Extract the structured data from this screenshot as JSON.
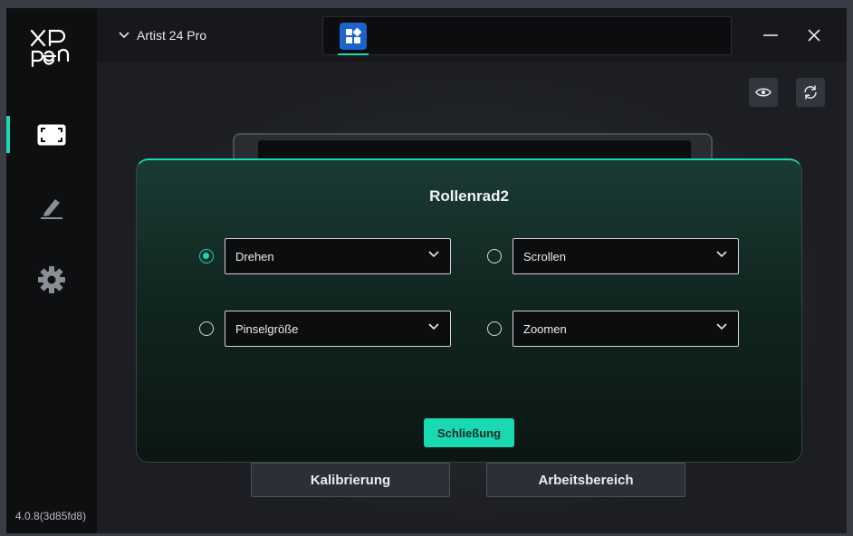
{
  "app": {
    "logo_text": "XP pen",
    "version": "4.0.8(3d85fd8)"
  },
  "header": {
    "device_name": "Artist 24 Pro",
    "add_tab_icon": "plus-icon",
    "remove_tab_icon": "minus-icon"
  },
  "sidebar": {
    "items": [
      {
        "icon": "display-area-icon",
        "active": true
      },
      {
        "icon": "pen-icon",
        "active": false
      },
      {
        "icon": "gear-icon",
        "active": false
      }
    ]
  },
  "main": {
    "calibrate_label": "Kalibrierung",
    "workspace_label": "Arbeitsbereich"
  },
  "modal": {
    "title": "Rollenrad2",
    "options": [
      {
        "value": "Drehen",
        "checked": true
      },
      {
        "value": "Scrollen",
        "checked": false
      },
      {
        "value": "Pinselgröße",
        "checked": false
      },
      {
        "value": "Zoomen",
        "checked": false
      }
    ],
    "close_label": "Schließung"
  },
  "colors": {
    "accent": "#19d9b3",
    "app_tab": "#1d63c9",
    "background": "#15171b"
  }
}
